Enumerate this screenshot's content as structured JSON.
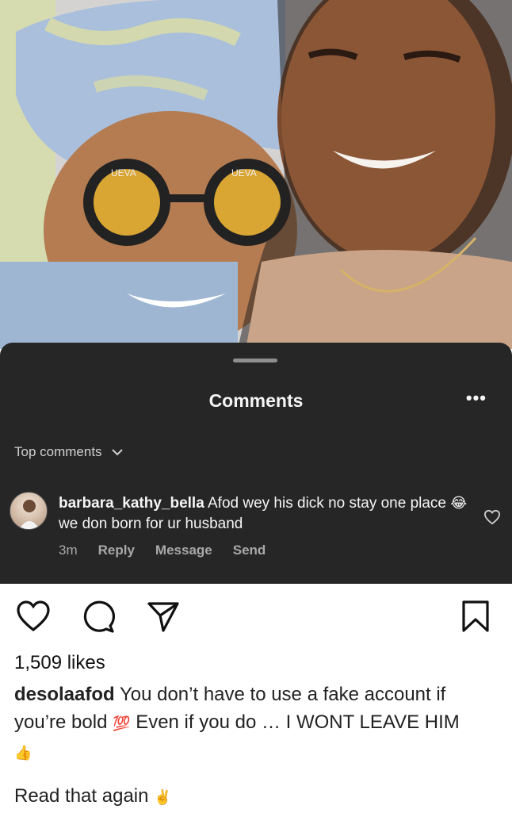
{
  "photo": {
    "description_icon": "photo-image",
    "glasses_text_left": "UEVA",
    "glasses_text_right": "UEVA"
  },
  "comments_sheet": {
    "title": "Comments",
    "more_icon": "more-horizontal-icon",
    "sort_label": "Top comments",
    "comment": {
      "username": "barbara_kathy_bella",
      "text_part1": "Afod wey his dick no stay one place",
      "emoji": "😂",
      "text_part2": "we don born for ur husband",
      "time": "3m",
      "reply_label": "Reply",
      "message_label": "Message",
      "send_label": "Send"
    }
  },
  "post": {
    "likes": "1,509 likes",
    "caption_user": "desolaafod",
    "caption_text": "You don’t have to use a fake account if you’re bold",
    "caption_emoji_100": "💯",
    "caption_text2": "Even if you do … I WONT LEAVE HIM",
    "caption_emoji_thumb": "👍",
    "caption_line2": "Read that again",
    "caption_emoji_victory": "✌️"
  }
}
